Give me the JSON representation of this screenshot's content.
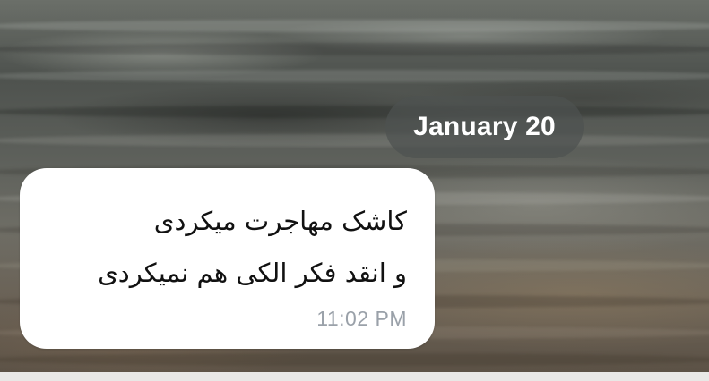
{
  "chat": {
    "date_separator": "January 20",
    "messages": [
      {
        "text": "کاشک مهاجرت میکردی\nو انقد فکر الکی هم نمیکردی",
        "time": "11:02 PM",
        "direction": "incoming"
      }
    ]
  },
  "colors": {
    "bubble_background": "#ffffff",
    "timestamp": "#9aa1a9",
    "date_pill_background": "#4e5250",
    "date_pill_text": "#ffffff"
  }
}
